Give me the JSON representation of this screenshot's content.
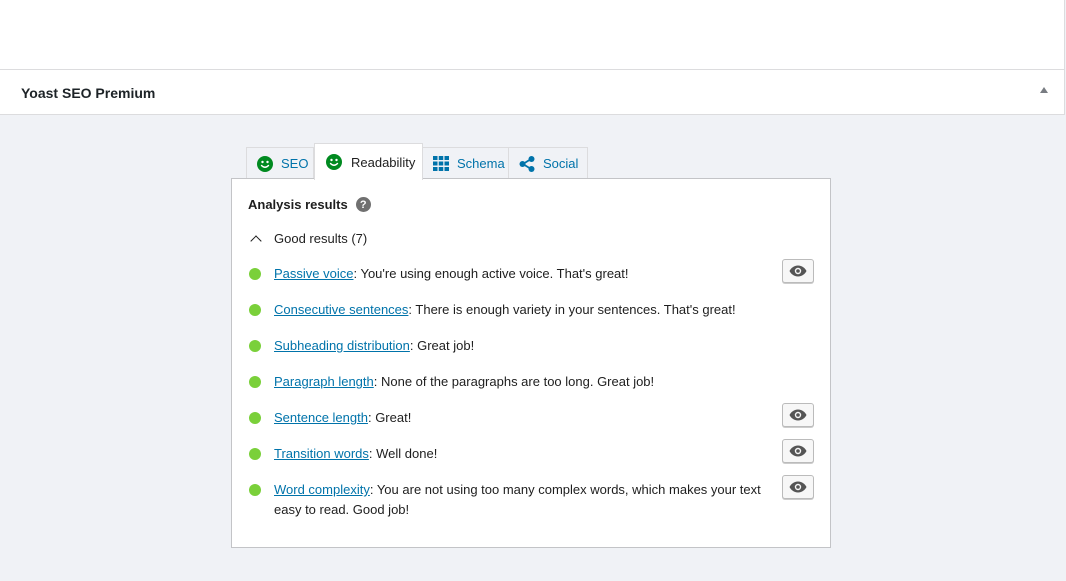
{
  "metabox": {
    "title": "Yoast SEO Premium"
  },
  "tabs": [
    {
      "id": "seo",
      "label": "SEO",
      "icon": "smiley-icon"
    },
    {
      "id": "readability",
      "label": "Readability",
      "icon": "smiley-icon",
      "active": true
    },
    {
      "id": "schema",
      "label": "Schema",
      "icon": "grid-icon"
    },
    {
      "id": "social",
      "label": "Social",
      "icon": "share-icon"
    }
  ],
  "analysis": {
    "heading": "Analysis results",
    "help_icon": "?",
    "good_results_label": "Good results (7)",
    "results": [
      {
        "link": "Passive voice",
        "text": ": You're using enough active voice. That's great!",
        "has_eye": true
      },
      {
        "link": "Consecutive sentences",
        "text": ": There is enough variety in your sentences. That's great!",
        "has_eye": false
      },
      {
        "link": "Subheading distribution",
        "text": ": Great job!",
        "has_eye": false
      },
      {
        "link": "Paragraph length",
        "text": ": None of the paragraphs are too long. Great job!",
        "has_eye": false
      },
      {
        "link": "Sentence length",
        "text": ": Great!",
        "has_eye": true
      },
      {
        "link": "Transition words",
        "text": ": Well done!",
        "has_eye": true
      },
      {
        "link": "Word complexity",
        "text": ": You are not using too many complex words, which makes your text easy to read. Good job!",
        "has_eye": true
      }
    ]
  },
  "colors": {
    "good": "#7ad03a",
    "link": "#0073aa",
    "smiley": "#008a20",
    "background": "#f0f2f6"
  }
}
